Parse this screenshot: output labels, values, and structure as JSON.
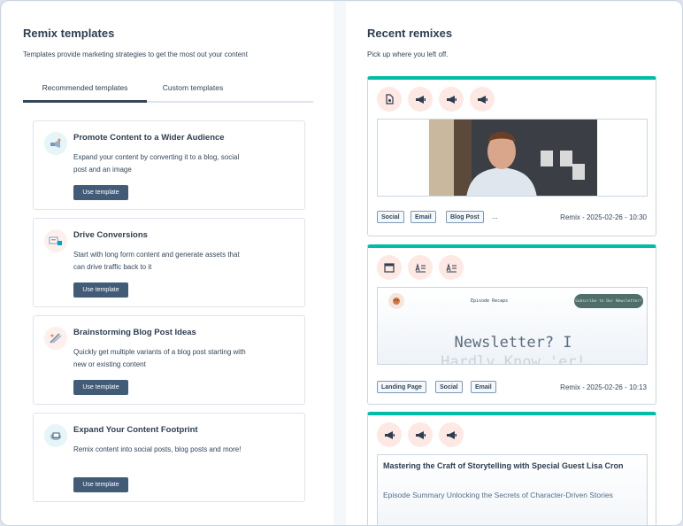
{
  "left": {
    "title": "Remix templates",
    "subtitle": "Templates provide marketing strategies to get the most out your content",
    "tabs": [
      {
        "label": "Recommended templates",
        "active": true
      },
      {
        "label": "Custom templates",
        "active": false
      }
    ],
    "cards": [
      {
        "title": "Promote Content to a Wider Audience",
        "desc": "Expand your content by converting it to a blog, social post and an image",
        "button": "Use template",
        "icon": "promote-icon"
      },
      {
        "title": "Drive Conversions",
        "desc": "Start with long form content and generate assets that can drive traffic back to it",
        "button": "Use template",
        "icon": "conversions-icon"
      },
      {
        "title": "Brainstorming Blog Post Ideas",
        "desc": "Quickly get multiple variants of a blog post starting with new or existing content",
        "button": "Use template",
        "icon": "brainstorm-icon"
      },
      {
        "title": "Expand Your Content Footprint",
        "desc": "Remix content into social posts, blog posts and more!",
        "button": "Use template",
        "icon": "footprint-icon"
      }
    ]
  },
  "right": {
    "title": "Recent remixes",
    "subtitle": "Pick up where you left off.",
    "remixes": [
      {
        "icons": [
          "file-icon",
          "megaphone-icon",
          "megaphone-icon",
          "megaphone-icon"
        ],
        "tags": [
          "Social",
          "Email",
          "Blog Post"
        ],
        "more": "...",
        "timestamp": "Remix - 2025-02-26 - 10:30"
      },
      {
        "icons": [
          "browser-icon",
          "text-doc-icon",
          "text-doc-icon"
        ],
        "tags": [
          "Landing Page",
          "Social",
          "Email"
        ],
        "timestamp": "Remix - 2025-02-26 - 10:13",
        "preview": {
          "nav_label": "Episode Recaps",
          "cta": "Subscribe to Our Newsletter!",
          "headline_1": "Newsletter? I",
          "headline_2": "Hardly Know 'er!"
        }
      },
      {
        "icons": [
          "megaphone-icon",
          "megaphone-icon",
          "megaphone-icon"
        ],
        "preview": {
          "title": "Mastering the Craft of Storytelling with Special Guest Lisa Cron",
          "summary": "Episode Summary Unlocking the Secrets of Character-Driven Stories"
        }
      }
    ]
  },
  "colors": {
    "accent": "#00bda5",
    "button": "#425b76",
    "icon_bg": "#fde8e4"
  }
}
